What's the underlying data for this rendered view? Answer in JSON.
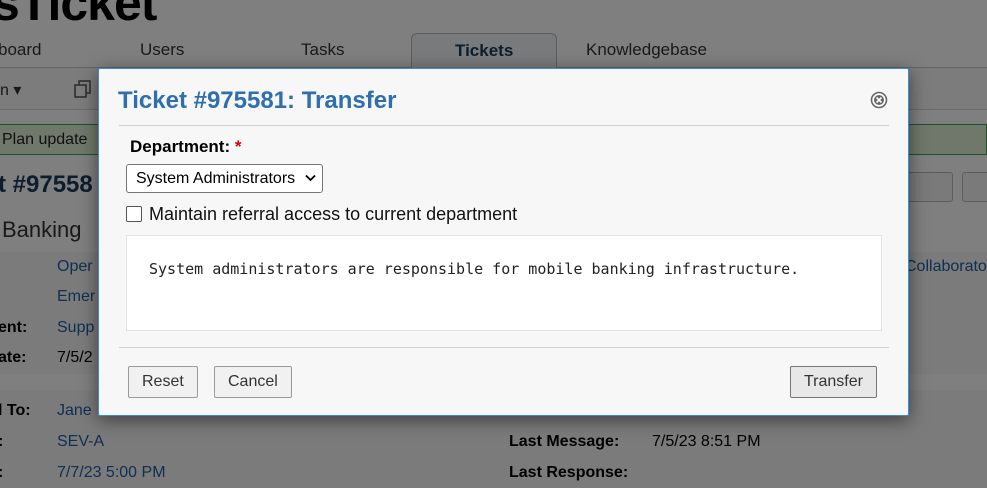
{
  "app": {
    "logo_text": "sTicket"
  },
  "nav": {
    "tabs": [
      {
        "label": "board"
      },
      {
        "label": "Users"
      },
      {
        "label": "Tasks"
      },
      {
        "label": "Tickets",
        "active": true
      },
      {
        "label": "Knowledgebase"
      }
    ]
  },
  "subbar": {
    "left_label": "n ▾"
  },
  "notice": {
    "text": "Plan update"
  },
  "ticket": {
    "number_fragment": "t #97558",
    "subject_fragment": "Banking"
  },
  "info": {
    "rows": [
      {
        "label": "",
        "value": "Oper"
      },
      {
        "label": "",
        "value": "Emer"
      },
      {
        "label": "ent:",
        "value": "Supp"
      },
      {
        "label": "ate:",
        "value": "7/5/2"
      }
    ],
    "collaborators_fragment": "Collaborato",
    "rows2": [
      {
        "label": "l To:",
        "value": "Jane"
      },
      {
        "label": ":",
        "value": "SEV-A"
      },
      {
        "label": ":",
        "value": "7/7/23 5:00 PM"
      }
    ],
    "last_message_label": "Last Message:",
    "last_message_value": "7/5/23 8:51 PM",
    "last_response_label": "Last Response:"
  },
  "dialog": {
    "title": "Ticket #975581: Transfer",
    "department_label": "Department:",
    "required_mark": "*",
    "department_selected": "System Administrators",
    "maintain_access_label": "Maintain referral access to current department",
    "maintain_access_checked": false,
    "description": "System administrators are responsible for mobile banking infrastructure.",
    "buttons": {
      "reset": "Reset",
      "cancel": "Cancel",
      "transfer": "Transfer"
    }
  },
  "colors": {
    "dialog_title": "#2f6fad",
    "dialog_border": "#3c8bd8",
    "link_blue": "#1e5fa6",
    "required": "#d40000",
    "notice_bg": "#def1d4",
    "notice_border": "#3aa34d"
  }
}
